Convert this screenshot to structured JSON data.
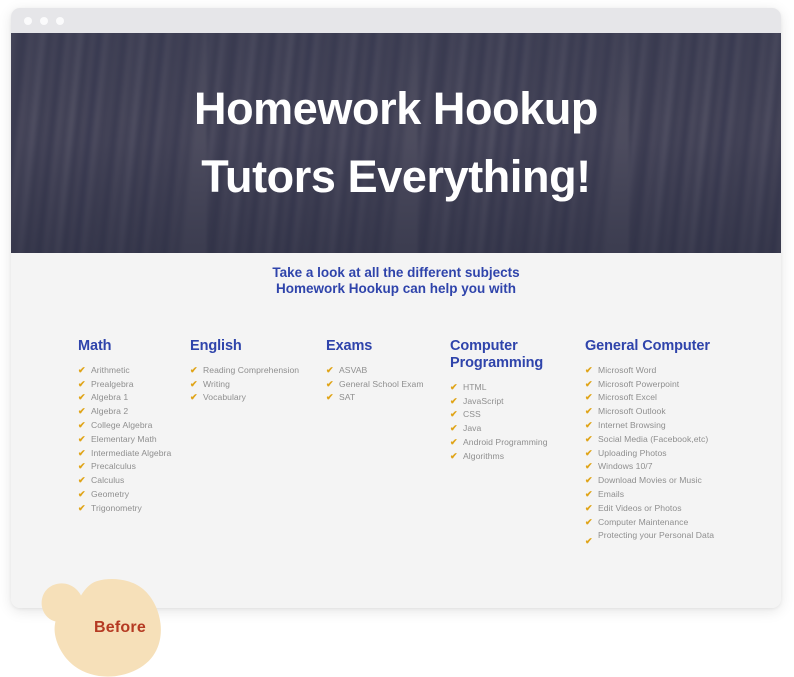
{
  "window": {
    "dots": [
      "dot-1",
      "dot-2",
      "dot-3"
    ]
  },
  "hero": {
    "headline_line1": "Homework Hookup",
    "headline_line2": "Tutors Everything!",
    "background_image": "bookshelf-photo",
    "overlay_color": "#3e3f5a"
  },
  "subtitle": {
    "line1": "Take a look at all the different subjects",
    "line2": "Homework Hookup can help you with",
    "color": "#2f44ab"
  },
  "colors": {
    "heading_blue": "#2f44ab",
    "check_gold": "#e0a418",
    "item_gray": "#8f8f8f",
    "page_bg": "#f4f4f4",
    "titlebar": "#e6e6e9",
    "badge_fill": "#f6e0b9",
    "badge_text": "#b53a22"
  },
  "icons": {
    "check": "✔"
  },
  "columns": [
    {
      "title": "Math",
      "items": [
        "Arithmetic",
        "Prealgebra",
        "Algebra 1",
        "Algebra 2",
        "College Algebra",
        "Elementary Math",
        "Intermediate Algebra",
        "Precalculus",
        "Calculus",
        "Geometry",
        "Trigonometry"
      ]
    },
    {
      "title": "English",
      "items": [
        "Reading Comprehension",
        "Writing",
        "Vocabulary"
      ]
    },
    {
      "title": "Exams",
      "items": [
        "ASVAB",
        "General School Exam",
        "SAT"
      ]
    },
    {
      "title": "Computer Programming",
      "title_line1": "Computer",
      "title_line2": "Programming",
      "items": [
        "HTML",
        "JavaScript",
        "CSS",
        "Java",
        "Android Programming",
        "Algorithms"
      ]
    },
    {
      "title": "General Computer",
      "items": [
        "Microsoft Word",
        "Microsoft Powerpoint",
        "Microsoft Excel",
        "Microsoft Outlook",
        "Internet Browsing",
        "Social Media (Facebook,etc)",
        "Uploading Photos",
        "Windows 10/7",
        "Download Movies or Music",
        "Emails",
        "Edit Videos or Photos",
        "Computer Maintenance",
        "Protecting your Personal Data"
      ]
    }
  ],
  "badge": {
    "label": "Before"
  }
}
